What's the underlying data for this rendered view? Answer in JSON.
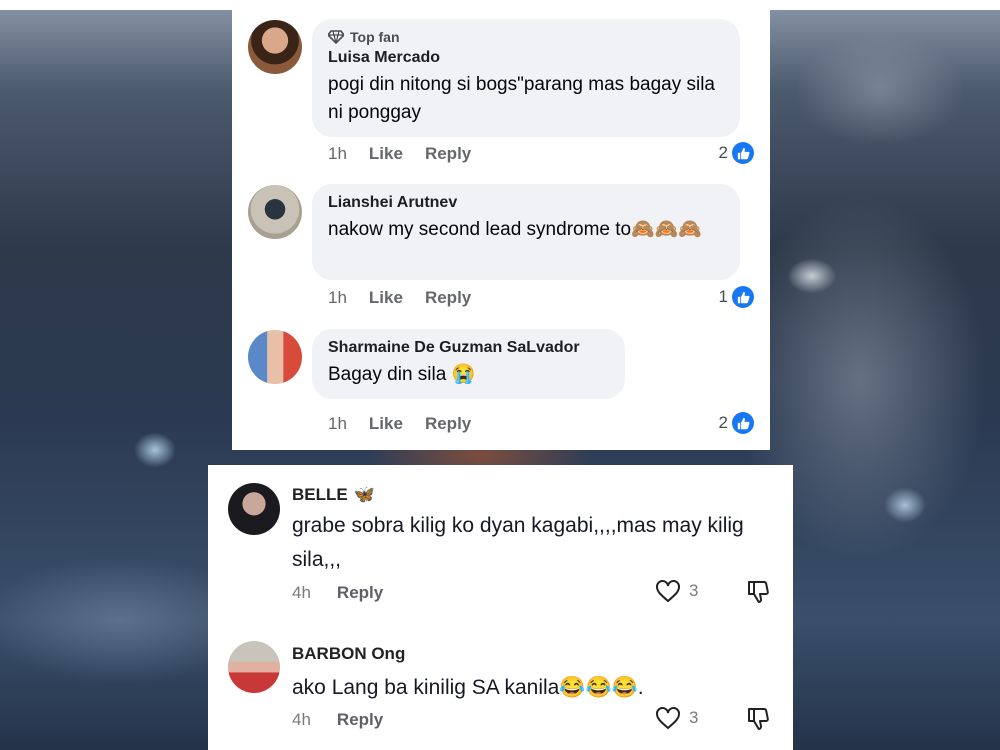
{
  "facebook": {
    "comments": [
      {
        "badge": "Top fan",
        "name": "Luisa Mercado",
        "text": "pogi din nitong si bogs\"parang mas bagay sila ni ponggay",
        "time": "1h",
        "like": "Like",
        "reply": "Reply",
        "reactions": "2"
      },
      {
        "name": "Lianshei Arutnev",
        "text": "nakow my second lead syndrome to🙈🙈🙈",
        "time": "1h",
        "like": "Like",
        "reply": "Reply",
        "reactions": "1"
      },
      {
        "name": "Sharmaine De Guzman SaLvador",
        "text": "Bagay din sila 😭",
        "time": "1h",
        "like": "Like",
        "reply": "Reply",
        "reactions": "2"
      }
    ],
    "icons": {
      "badge": "diamond-icon",
      "reaction": "thumbs-up-icon"
    },
    "colors": {
      "accent": "#1877f2",
      "bubble": "#f0f2f5"
    }
  },
  "tiktok": {
    "comments": [
      {
        "name": "BELLE",
        "name_emoji": "🦋",
        "text": "grabe sobra kilig ko dyan kagabi,,,,mas may kilig sila,,,",
        "time": "4h",
        "reply": "Reply",
        "likes": "3"
      },
      {
        "name": "BARBON Ong",
        "text": "ako Lang ba kinilig SA kanila😂😂😂.",
        "time": "4h",
        "reply": "Reply",
        "likes": "3"
      }
    ],
    "icons": {
      "like": "heart-outline-icon",
      "dislike": "thumbs-down-icon"
    }
  }
}
